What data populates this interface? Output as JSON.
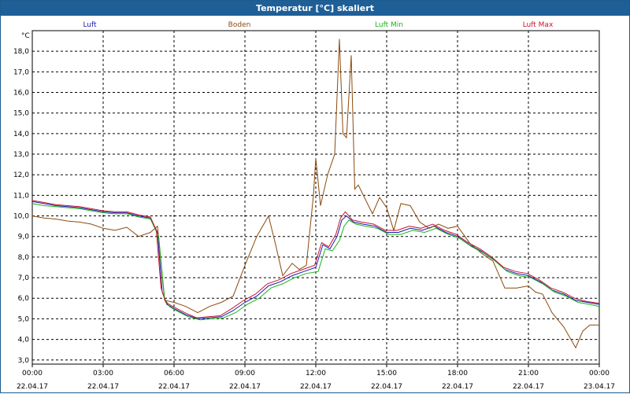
{
  "window": {
    "title": "Temperatur [°C] skaliert"
  },
  "chart_data": {
    "type": "line",
    "title": "Temperatur [°C] skaliert",
    "ylabel": "°C",
    "ylim": [
      2.8,
      19.0
    ],
    "xlim": [
      0,
      24
    ],
    "grid": true,
    "legend_position": "top",
    "y_ticks": [
      "3,0",
      "4,0",
      "5,0",
      "6,0",
      "7,0",
      "8,0",
      "9,0",
      "10,0",
      "11,0",
      "12,0",
      "13,0",
      "14,0",
      "15,0",
      "16,0",
      "17,0",
      "18,0"
    ],
    "x_ticks": [
      {
        "time": "00:00",
        "date": "22.04.17"
      },
      {
        "time": "03:00",
        "date": "22.04.17"
      },
      {
        "time": "06:00",
        "date": "22.04.17"
      },
      {
        "time": "09:00",
        "date": "22.04.17"
      },
      {
        "time": "12:00",
        "date": "22.04.17"
      },
      {
        "time": "15:00",
        "date": "22.04.17"
      },
      {
        "time": "18:00",
        "date": "22.04.17"
      },
      {
        "time": "21:00",
        "date": "22.04.17"
      },
      {
        "time": "00:00",
        "date": "23.04.17"
      }
    ],
    "series": [
      {
        "name": "Luft",
        "color": "#1a1ab4",
        "x": [
          0,
          0.5,
          1,
          1.5,
          2,
          2.5,
          3,
          3.5,
          4,
          4.5,
          5,
          5.3,
          5.5,
          5.7,
          6,
          6.5,
          7,
          7.5,
          8,
          8.5,
          9,
          9.5,
          10,
          10.5,
          11,
          11.5,
          12,
          12.3,
          12.6,
          12.9,
          13.1,
          13.3,
          13.6,
          14,
          14.5,
          15,
          15.5,
          16,
          16.5,
          17,
          17.5,
          18,
          18.5,
          19,
          19.5,
          20,
          20.5,
          21,
          21.5,
          22,
          22.5,
          23,
          23.5,
          24
        ],
        "values": [
          10.7,
          10.6,
          10.5,
          10.45,
          10.4,
          10.3,
          10.2,
          10.15,
          10.15,
          10.0,
          9.9,
          9.2,
          6.3,
          5.7,
          5.5,
          5.2,
          5.0,
          5.05,
          5.1,
          5.4,
          5.8,
          6.1,
          6.6,
          6.8,
          7.1,
          7.3,
          7.5,
          8.6,
          8.4,
          9.0,
          9.8,
          10.0,
          9.7,
          9.6,
          9.5,
          9.2,
          9.2,
          9.4,
          9.3,
          9.5,
          9.2,
          9.0,
          8.6,
          8.3,
          7.9,
          7.4,
          7.2,
          7.1,
          6.8,
          6.4,
          6.2,
          5.9,
          5.8,
          5.7
        ]
      },
      {
        "name": "Boden",
        "color": "#8b4a0e",
        "x": [
          0,
          0.5,
          1,
          1.5,
          2,
          2.5,
          3,
          3.5,
          4,
          4.5,
          5,
          5.3,
          5.6,
          6,
          6.5,
          7,
          7.5,
          8,
          8.5,
          9,
          9.5,
          10,
          10.3,
          10.6,
          11,
          11.3,
          11.6,
          11.9,
          12,
          12.2,
          12.5,
          12.8,
          13.0,
          13.15,
          13.3,
          13.5,
          13.65,
          13.8,
          14.1,
          14.4,
          14.7,
          15,
          15.3,
          15.6,
          16,
          16.4,
          16.8,
          17.2,
          17.6,
          18,
          18.5,
          19,
          19.5,
          20,
          20.5,
          21,
          21.3,
          21.6,
          22,
          22.5,
          23,
          23.3,
          23.6,
          24
        ],
        "values": [
          10.0,
          9.9,
          9.85,
          9.75,
          9.7,
          9.6,
          9.4,
          9.3,
          9.45,
          9.0,
          9.2,
          9.5,
          5.9,
          5.8,
          5.6,
          5.3,
          5.6,
          5.8,
          6.1,
          7.6,
          9.0,
          10.0,
          8.6,
          7.1,
          7.7,
          7.4,
          7.6,
          11.0,
          12.8,
          10.5,
          12.0,
          13.0,
          18.6,
          14.0,
          13.8,
          17.8,
          11.3,
          11.5,
          10.8,
          10.1,
          10.9,
          10.4,
          9.3,
          10.6,
          10.5,
          9.7,
          9.4,
          9.6,
          9.4,
          9.5,
          8.7,
          8.2,
          7.8,
          6.5,
          6.5,
          6.6,
          6.3,
          6.2,
          5.3,
          4.6,
          3.6,
          4.4,
          4.7,
          4.7
        ]
      },
      {
        "name": "Luft Min",
        "color": "#19b419",
        "x": [
          0,
          0.5,
          1,
          1.5,
          2,
          2.5,
          3,
          3.5,
          4,
          4.5,
          5,
          5.35,
          5.6,
          5.8,
          6.1,
          6.6,
          7.1,
          7.6,
          8.1,
          8.6,
          9.1,
          9.6,
          10.1,
          10.6,
          11.1,
          11.6,
          12.1,
          12.4,
          12.7,
          13.0,
          13.2,
          13.4,
          13.7,
          14.1,
          14.6,
          15.1,
          15.6,
          16.1,
          16.6,
          17.1,
          17.6,
          18.1,
          18.6,
          19.1,
          19.6,
          20.1,
          20.6,
          21.1,
          21.6,
          22.1,
          22.6,
          23.1,
          23.6,
          24
        ],
        "values": [
          10.6,
          10.5,
          10.45,
          10.4,
          10.35,
          10.25,
          10.15,
          10.1,
          10.1,
          9.95,
          9.85,
          9.0,
          6.0,
          5.6,
          5.4,
          5.1,
          4.95,
          5.0,
          5.05,
          5.3,
          5.7,
          6.0,
          6.5,
          6.7,
          7.0,
          7.2,
          7.3,
          8.4,
          8.3,
          8.8,
          9.5,
          9.8,
          9.6,
          9.5,
          9.4,
          9.1,
          9.1,
          9.3,
          9.2,
          9.4,
          9.1,
          8.9,
          8.5,
          8.2,
          7.8,
          7.3,
          7.1,
          7.0,
          6.7,
          6.3,
          6.1,
          5.8,
          5.7,
          5.6
        ]
      },
      {
        "name": "Luft Max",
        "color": "#c8142d",
        "x": [
          0,
          0.5,
          1,
          1.5,
          2,
          2.5,
          3,
          3.5,
          4,
          4.5,
          5,
          5.25,
          5.45,
          5.65,
          5.95,
          6.45,
          6.95,
          7.45,
          7.95,
          8.45,
          8.95,
          9.45,
          9.95,
          10.45,
          10.95,
          11.45,
          11.95,
          12.25,
          12.55,
          12.85,
          13.05,
          13.25,
          13.55,
          13.95,
          14.45,
          14.95,
          15.45,
          15.95,
          16.45,
          16.95,
          17.45,
          17.95,
          18.45,
          18.95,
          19.45,
          19.95,
          20.45,
          20.95,
          21.45,
          21.95,
          22.45,
          22.95,
          23.45,
          24
        ],
        "values": [
          10.75,
          10.65,
          10.55,
          10.5,
          10.45,
          10.35,
          10.25,
          10.2,
          10.2,
          10.05,
          9.95,
          9.3,
          6.5,
          5.8,
          5.6,
          5.3,
          5.05,
          5.1,
          5.15,
          5.5,
          5.9,
          6.2,
          6.7,
          6.9,
          7.2,
          7.4,
          7.6,
          8.7,
          8.5,
          9.1,
          9.9,
          10.2,
          9.8,
          9.7,
          9.6,
          9.3,
          9.3,
          9.5,
          9.4,
          9.6,
          9.3,
          9.1,
          8.7,
          8.4,
          8.0,
          7.5,
          7.3,
          7.2,
          6.9,
          6.5,
          6.3,
          6.0,
          5.85,
          5.75
        ]
      }
    ]
  }
}
